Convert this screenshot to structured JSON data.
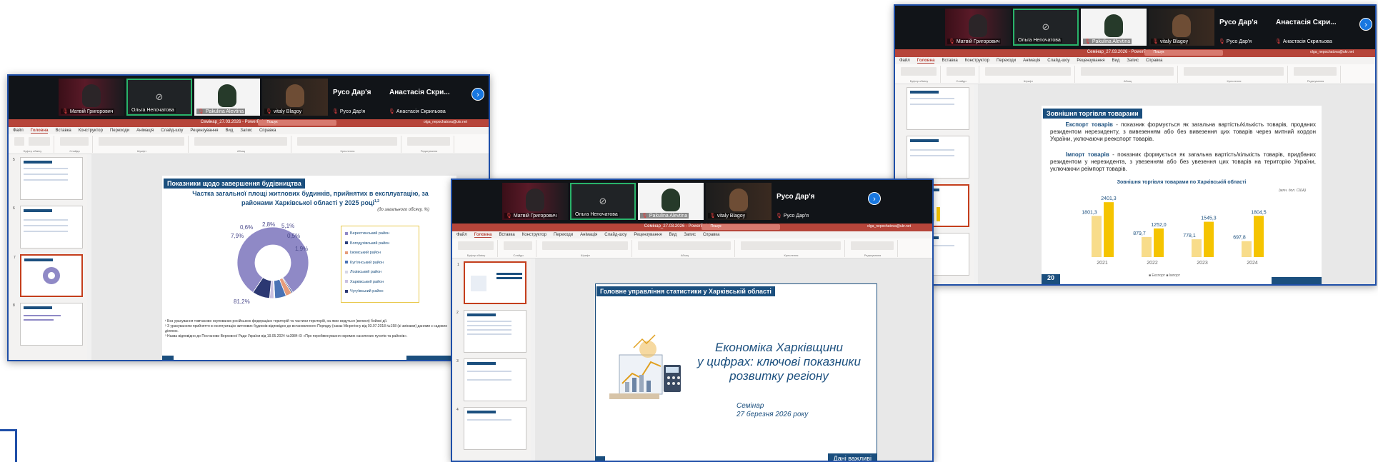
{
  "participants": {
    "p1": "Матвій Григорович",
    "p2": "Ольга Непочатова",
    "p3": "Pakulina Alevtina",
    "p4": "vitaly Blagoy",
    "p5_big": "Русо Дар'я",
    "p5": "Русо Дар'я",
    "p6_big": "Анастасія Скри...",
    "p6": "Анастасія Скрильова",
    "next_icon": "chevron-right-icon"
  },
  "ppt": {
    "title": "Семінар_27.03.2026 - PowerPoint",
    "search": "Пошук",
    "account": "olga_nepochatova@ukr.net",
    "menu": [
      "Файл",
      "Головна",
      "Вставка",
      "Конструктор",
      "Переходи",
      "Анімація",
      "Слайд-шоу",
      "Рецензування",
      "Вид",
      "Запис",
      "Справка"
    ],
    "groups": [
      "Буфер обміну",
      "Слайди",
      "Шрифт",
      "Абзац",
      "Креслення",
      "Редагування"
    ]
  },
  "slide_a": {
    "header": "Показники щодо завершення будівництва",
    "title": "Частка загальної площі житлових будинків, прийнятих в експлуатацію, за районами Харківської області у 2025 році",
    "title_sup": "1,2",
    "subtitle": "(до загального обсягу, %)",
    "labels": [
      "0,6%",
      "2,8%",
      "5,1%",
      "7,9%",
      "0,5%",
      "1,9%",
      "81,2%"
    ],
    "legend": [
      "Берестинський район",
      "Богодухівський район",
      "Ізюмський район",
      "Куп'янський район",
      "Лозівський район",
      "Харківський район",
      "Чугуївський район"
    ],
    "notes": [
      "¹ Без урахування тимчасово окупованих російською федерацією територій та частини територій, на яких ведуться (велися) бойові дії.",
      "² З урахуванням прийняття в експлуатацію житлових будинків відповідно до встановленого Порядку (наказ Мінрегіону від 03.07.2018 №158 (зі змінами) даними з садових ділянок.",
      "³ Назва відповідно до Постанови Верховної Ради України від 19.05.2024 №3984-ІХ «Про перейменування окремих населених пунктів та районів»."
    ]
  },
  "slide_b": {
    "header": "Зовнішня торгівля товарами",
    "p1_bold": "Експорт товарів",
    "p1": " - показник формується як загальна вартість/кількість товарів, проданих резидентом нерезиденту, з вивезенням або без вивезення цих товарів через митний кордон України, уключаючи реекспорт товарів.",
    "p2_bold": "Імпорт товарів",
    "p2": " - показник формується як загальна вартість/кількість товарів, придбаних резидентом у нерезидента, з увезенням або без увезення цих товарів на територію України, уключаючи реімпорт товарів.",
    "chart_title": "Зовнішня торгівля товарами по Харківській області",
    "unit": "(млн. дол. США)",
    "legend": "■ Експорт   ■ Імпорт",
    "page": "20"
  },
  "slide_c": {
    "header": "Головне управління статистики у Харківській області",
    "title_lines": [
      "Економіка Харківщини",
      "у цифрах: ключові показники",
      "розвитку регіону"
    ],
    "seminar": "Семінар",
    "date": "27 березня 2026 року",
    "badge": "Дані важливі"
  },
  "chart_data": {
    "type": "bar",
    "categories": [
      "2021",
      "2022",
      "2023",
      "2024"
    ],
    "series": [
      {
        "name": "Експорт",
        "values": [
          1801.3,
          879.7,
          778.1,
          697.8
        ],
        "color": "#f8dc8a"
      },
      {
        "name": "Імпорт",
        "values": [
          2401.3,
          1252.0,
          1545.3,
          1804.5
        ],
        "color": "#f5c400"
      }
    ],
    "value_labels": {
      "Експорт": [
        "1801,3",
        "879,7",
        "778,1",
        "697,8"
      ],
      "Імпорт": [
        "2401,3",
        "1252,0",
        "1545,3",
        "1804,5"
      ]
    },
    "title": "Зовнішня торгівля товарами по Харківській області",
    "ylabel": "(млн. дол. США)",
    "ylim": [
      0,
      2500
    ]
  },
  "donut_data": {
    "type": "pie",
    "values": [
      81.2,
      0.6,
      2.8,
      5.1,
      0.5,
      1.9,
      7.9
    ],
    "colors": [
      "#8f89c6",
      "#2b3f7a",
      "#e69c7a",
      "#4a73b5",
      "#d6d6e6",
      "#c9c0e0",
      "#2c3872"
    ]
  },
  "colors": {
    "accent": "#1b4f7e",
    "frame": "#1f4fa8",
    "ppt_red": "#b6453a"
  }
}
